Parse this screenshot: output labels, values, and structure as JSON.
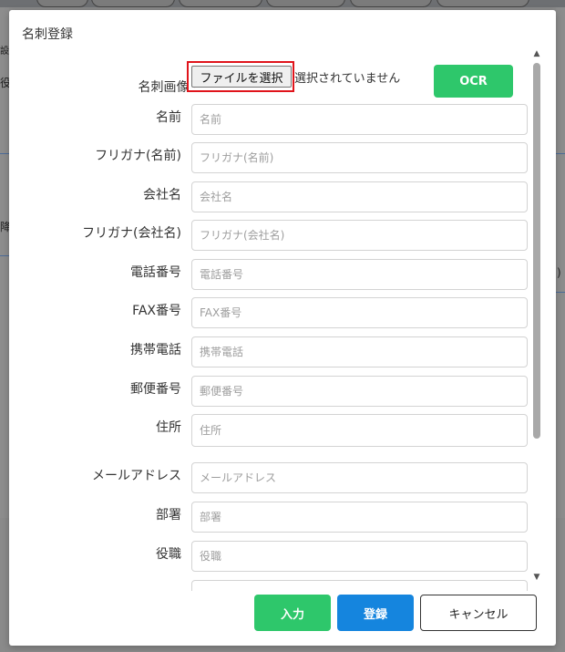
{
  "background": {
    "fragments": [
      "設",
      "役",
      "降",
      ")"
    ]
  },
  "modal": {
    "title": "名刺登録",
    "image_field": {
      "label": "名刺画像",
      "required_mark": "*",
      "file_button_label": "ファイルを選択",
      "file_status": "選択されていません",
      "ocr_label": "OCR"
    },
    "fields": [
      {
        "label": "名前",
        "placeholder": "名前"
      },
      {
        "label": "フリガナ(名前)",
        "placeholder": "フリガナ(名前)"
      },
      {
        "label": "会社名",
        "placeholder": "会社名"
      },
      {
        "label": "フリガナ(会社名)",
        "placeholder": "フリガナ(会社名)"
      },
      {
        "label": "電話番号",
        "placeholder": "電話番号"
      },
      {
        "label": "FAX番号",
        "placeholder": "FAX番号"
      },
      {
        "label": "携帯電話",
        "placeholder": "携帯電話"
      },
      {
        "label": "郵便番号",
        "placeholder": "郵便番号"
      },
      {
        "label": "住所",
        "placeholder": "住所"
      },
      {
        "label": "メールアドレス",
        "placeholder": "メールアドレス"
      },
      {
        "label": "部署",
        "placeholder": "部署"
      },
      {
        "label": "役職",
        "placeholder": "役職"
      }
    ],
    "footer": {
      "input_label": "入力",
      "register_label": "登録",
      "cancel_label": "キャンセル"
    },
    "colors": {
      "green": "#2ec76b",
      "blue": "#1585de",
      "required": "#e03131",
      "highlight": "#e0141b"
    }
  }
}
